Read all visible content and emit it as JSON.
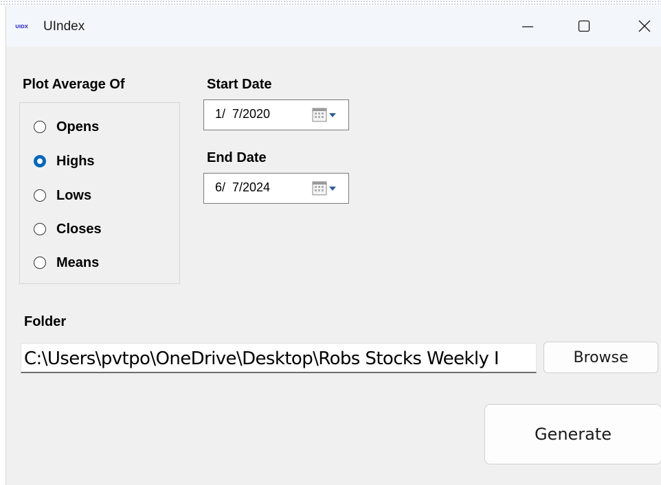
{
  "window": {
    "title": "UIndex",
    "app_icon_text": "UIDX"
  },
  "plot_group": {
    "label": "Plot Average Of",
    "options": [
      {
        "label": "Opens",
        "checked": false
      },
      {
        "label": "Highs",
        "checked": true
      },
      {
        "label": "Lows",
        "checked": false
      },
      {
        "label": "Closes",
        "checked": false
      },
      {
        "label": "Means",
        "checked": false
      }
    ],
    "selected": "Highs"
  },
  "start_date": {
    "label": "Start Date",
    "value": "1/  7/2020"
  },
  "end_date": {
    "label": "End Date",
    "value": "6/  7/2024"
  },
  "folder": {
    "label": "Folder",
    "value": "C:\\Users\\pvtpo\\OneDrive\\Desktop\\Robs Stocks Weekly I",
    "browse_label": "Browse"
  },
  "generate_label": "Generate",
  "colors": {
    "accent": "#0067c0",
    "window_bg": "#f0f0f0",
    "titlebar_bg": "#f3f6fb"
  }
}
